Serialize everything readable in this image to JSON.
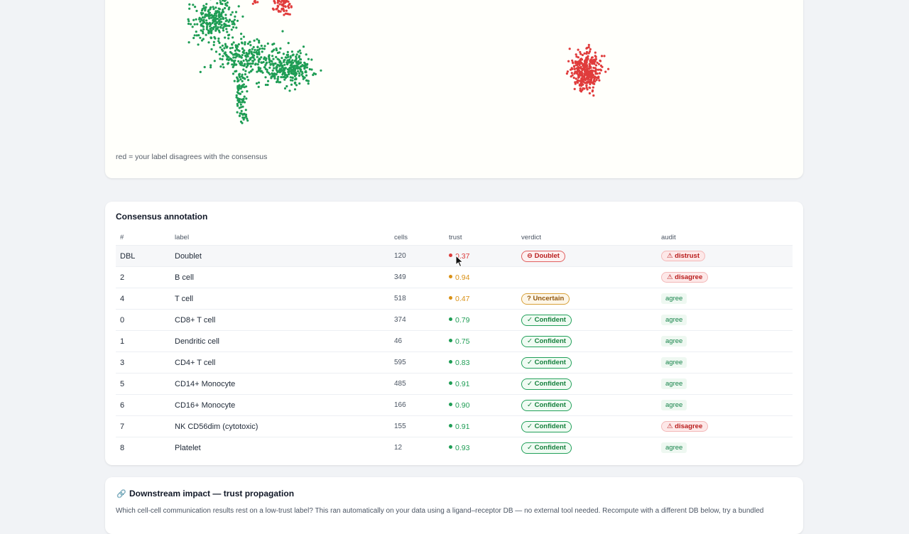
{
  "plot": {
    "caption": "red = your label disagrees with the consensus",
    "colors": {
      "agree": "#1f9d55",
      "disagree": "#e03c3c"
    }
  },
  "consensus": {
    "title": "Consensus annotation",
    "headers": {
      "id": "#",
      "label": "label",
      "cells": "cells",
      "trust": "trust",
      "verdict": "verdict",
      "audit": "audit"
    },
    "rows": [
      {
        "id": "DBL",
        "label": "Doublet",
        "cells": "120",
        "trust": "0.37",
        "trust_color": "#dc3b3b",
        "verdict": "⊖ Doublet",
        "verdict_kind": "doublet",
        "audit": "⚠ distrust",
        "audit_kind": "warn"
      },
      {
        "id": "2",
        "label": "B cell",
        "cells": "349",
        "trust": "0.94",
        "trust_color": "#d99116",
        "verdict": "",
        "verdict_kind": "none",
        "audit": "⚠ disagree",
        "audit_kind": "warn"
      },
      {
        "id": "4",
        "label": "T cell",
        "cells": "518",
        "trust": "0.47",
        "trust_color": "#d99116",
        "verdict": "? Uncertain",
        "verdict_kind": "uncertain",
        "audit": "agree",
        "audit_kind": "agree"
      },
      {
        "id": "0",
        "label": "CD8+ T cell",
        "cells": "374",
        "trust": "0.79",
        "trust_color": "#1f9d55",
        "verdict": "✓ Confident",
        "verdict_kind": "confident",
        "audit": "agree",
        "audit_kind": "agree"
      },
      {
        "id": "1",
        "label": "Dendritic cell",
        "cells": "46",
        "trust": "0.75",
        "trust_color": "#1f9d55",
        "verdict": "✓ Confident",
        "verdict_kind": "confident",
        "audit": "agree",
        "audit_kind": "agree"
      },
      {
        "id": "3",
        "label": "CD4+ T cell",
        "cells": "595",
        "trust": "0.83",
        "trust_color": "#1f9d55",
        "verdict": "✓ Confident",
        "verdict_kind": "confident",
        "audit": "agree",
        "audit_kind": "agree"
      },
      {
        "id": "5",
        "label": "CD14+ Monocyte",
        "cells": "485",
        "trust": "0.91",
        "trust_color": "#1f9d55",
        "verdict": "✓ Confident",
        "verdict_kind": "confident",
        "audit": "agree",
        "audit_kind": "agree"
      },
      {
        "id": "6",
        "label": "CD16+ Monocyte",
        "cells": "166",
        "trust": "0.90",
        "trust_color": "#1f9d55",
        "verdict": "✓ Confident",
        "verdict_kind": "confident",
        "audit": "agree",
        "audit_kind": "agree"
      },
      {
        "id": "7",
        "label": "NK CD56dim (cytotoxic)",
        "cells": "155",
        "trust": "0.91",
        "trust_color": "#1f9d55",
        "verdict": "✓ Confident",
        "verdict_kind": "confident",
        "audit": "⚠ disagree",
        "audit_kind": "warn"
      },
      {
        "id": "8",
        "label": "Platelet",
        "cells": "12",
        "trust": "0.93",
        "trust_color": "#1f9d55",
        "verdict": "✓ Confident",
        "verdict_kind": "confident",
        "audit": "agree",
        "audit_kind": "agree"
      }
    ]
  },
  "impact": {
    "icon": "link-icon",
    "title": "Downstream impact — trust propagation",
    "description": "Which cell-cell communication results rest on a low-trust label? This ran automatically on your data using a ligand–receptor DB — no external tool needed. Recompute with a different DB below, try a bundled"
  }
}
